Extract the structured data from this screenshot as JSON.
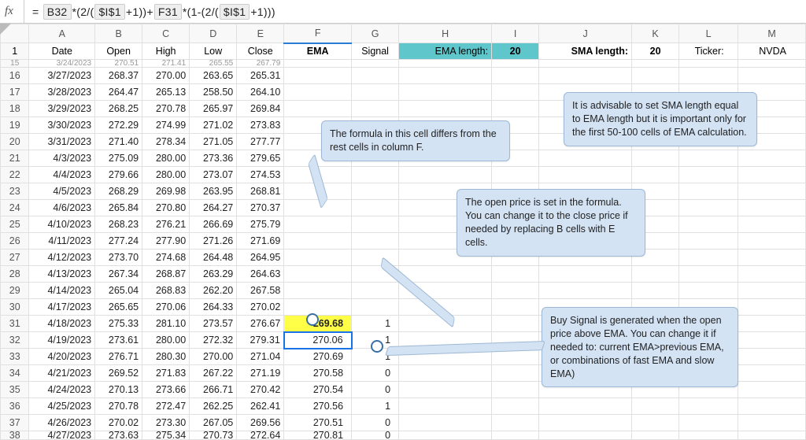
{
  "formula": {
    "eq": "=",
    "t1": "B32",
    "s1": " *(2/( ",
    "t2": "$I$1",
    "s2": " +1))+ ",
    "t3": "F31",
    "s3": " *(1-(2/( ",
    "t4": "$I$1",
    "s4": " +1)))"
  },
  "col_letters": [
    "",
    "A",
    "B",
    "C",
    "D",
    "E",
    "F",
    "G",
    "H",
    "I",
    "J",
    "K",
    "L",
    "M"
  ],
  "hdr": {
    "date": "Date",
    "open": "Open",
    "high": "High",
    "low": "Low",
    "close": "Close",
    "ema": "EMA",
    "signal": "Signal",
    "ema_len_lbl": "EMA length:",
    "ema_len": "20",
    "sma_len_lbl": "SMA length:",
    "sma_len": "20",
    "ticker_lbl": "Ticker:",
    "ticker": "NVDA"
  },
  "partial_top": {
    "rn": "15",
    "date": "3/24/2023",
    "o": "270.51",
    "h": "271.41",
    "l": "265.55",
    "c": "267.79"
  },
  "rows": [
    {
      "rn": "16",
      "date": "3/27/2023",
      "o": "268.37",
      "h": "270.00",
      "l": "263.65",
      "c": "265.31"
    },
    {
      "rn": "17",
      "date": "3/28/2023",
      "o": "264.47",
      "h": "265.13",
      "l": "258.50",
      "c": "264.10"
    },
    {
      "rn": "18",
      "date": "3/29/2023",
      "o": "268.25",
      "h": "270.78",
      "l": "265.97",
      "c": "269.84"
    },
    {
      "rn": "19",
      "date": "3/30/2023",
      "o": "272.29",
      "h": "274.99",
      "l": "271.02",
      "c": "273.83"
    },
    {
      "rn": "20",
      "date": "3/31/2023",
      "o": "271.40",
      "h": "278.34",
      "l": "271.05",
      "c": "277.77"
    },
    {
      "rn": "21",
      "date": "4/3/2023",
      "o": "275.09",
      "h": "280.00",
      "l": "273.36",
      "c": "279.65"
    },
    {
      "rn": "22",
      "date": "4/4/2023",
      "o": "279.66",
      "h": "280.00",
      "l": "273.07",
      "c": "274.53"
    },
    {
      "rn": "23",
      "date": "4/5/2023",
      "o": "268.29",
      "h": "269.98",
      "l": "263.95",
      "c": "268.81"
    },
    {
      "rn": "24",
      "date": "4/6/2023",
      "o": "265.84",
      "h": "270.80",
      "l": "264.27",
      "c": "270.37"
    },
    {
      "rn": "25",
      "date": "4/10/2023",
      "o": "268.23",
      "h": "276.21",
      "l": "266.69",
      "c": "275.79"
    },
    {
      "rn": "26",
      "date": "4/11/2023",
      "o": "277.24",
      "h": "277.90",
      "l": "271.26",
      "c": "271.69"
    },
    {
      "rn": "27",
      "date": "4/12/2023",
      "o": "273.70",
      "h": "274.68",
      "l": "264.48",
      "c": "264.95"
    },
    {
      "rn": "28",
      "date": "4/13/2023",
      "o": "267.34",
      "h": "268.87",
      "l": "263.29",
      "c": "264.63"
    },
    {
      "rn": "29",
      "date": "4/14/2023",
      "o": "265.04",
      "h": "268.83",
      "l": "262.20",
      "c": "267.58"
    },
    {
      "rn": "30",
      "date": "4/17/2023",
      "o": "265.65",
      "h": "270.06",
      "l": "264.33",
      "c": "270.02"
    },
    {
      "rn": "31",
      "date": "4/18/2023",
      "o": "275.33",
      "h": "281.10",
      "l": "273.57",
      "c": "276.67",
      "ema": "269.68",
      "sig": "1",
      "hl": true
    },
    {
      "rn": "32",
      "date": "4/19/2023",
      "o": "273.61",
      "h": "280.00",
      "l": "272.32",
      "c": "279.31",
      "ema": "270.06",
      "sig": "1",
      "active": true
    },
    {
      "rn": "33",
      "date": "4/20/2023",
      "o": "276.71",
      "h": "280.30",
      "l": "270.00",
      "c": "271.04",
      "ema": "270.69",
      "sig": "1"
    },
    {
      "rn": "34",
      "date": "4/21/2023",
      "o": "269.52",
      "h": "271.83",
      "l": "267.22",
      "c": "271.19",
      "ema": "270.58",
      "sig": "0"
    },
    {
      "rn": "35",
      "date": "4/24/2023",
      "o": "270.13",
      "h": "273.66",
      "l": "266.71",
      "c": "270.42",
      "ema": "270.54",
      "sig": "0"
    },
    {
      "rn": "36",
      "date": "4/25/2023",
      "o": "270.78",
      "h": "272.47",
      "l": "262.25",
      "c": "262.41",
      "ema": "270.56",
      "sig": "1"
    },
    {
      "rn": "37",
      "date": "4/26/2023",
      "o": "270.02",
      "h": "273.30",
      "l": "267.05",
      "c": "269.56",
      "ema": "270.51",
      "sig": "0"
    }
  ],
  "partial_bot": {
    "rn": "38",
    "date": "4/27/2023",
    "o": "273.63",
    "h": "275.34",
    "l": "270.73",
    "c": "272.64",
    "ema": "270.81",
    "sig": "0"
  },
  "callouts": {
    "c1": "The formula in this cell differs from the rest cells in column F.",
    "c2": "It is advisable to set SMA length equal to EMA length but it is important only for the first 50-100 cells of EMA calculation.",
    "c3": "The open price is set in the formula. You can change it to the close price if needed by replacing B cells with E cells.",
    "c4": "Buy Signal is generated when the open price above EMA. You can change it if needed to: current EMA>previous EMA, or combinations of fast EMA and slow EMA)"
  }
}
